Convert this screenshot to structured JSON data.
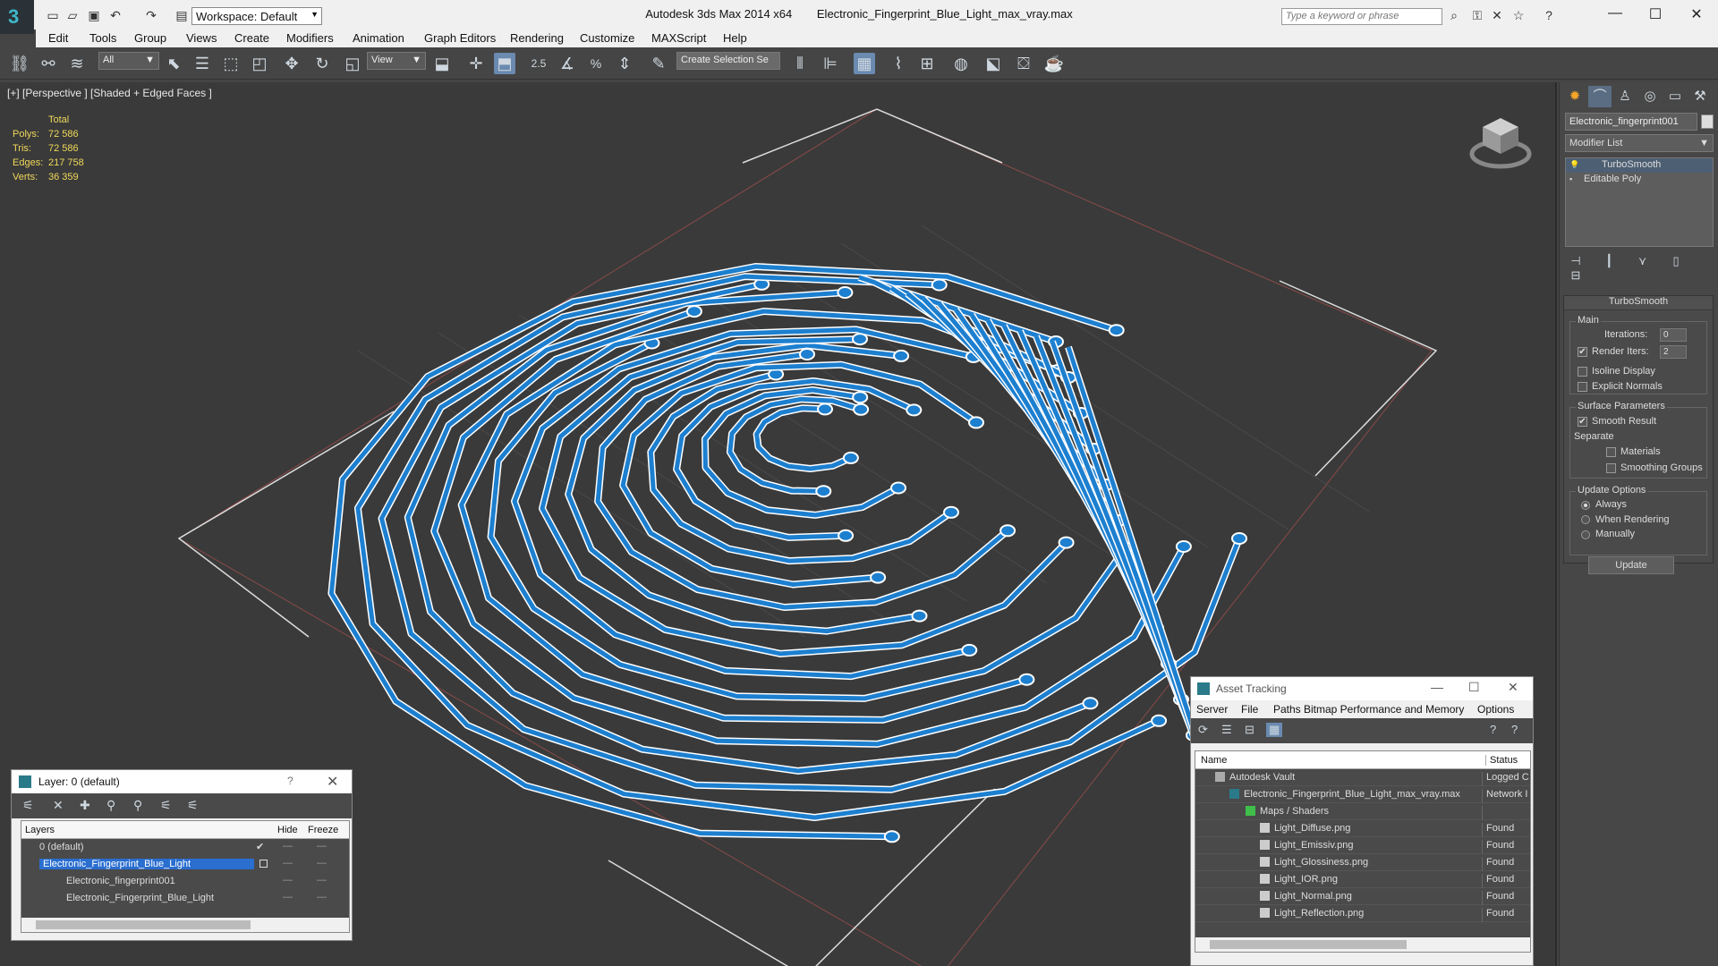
{
  "titlebar": {
    "workspace": "Workspace: Default",
    "app_name": "Autodesk 3ds Max  2014 x64",
    "file_name": "Electronic_Fingerprint_Blue_Light_max_vray.max",
    "search_placeholder": "Type a keyword or phrase"
  },
  "menubar": {
    "items": [
      "Edit",
      "Tools",
      "Group",
      "Views",
      "Create",
      "Modifiers",
      "Animation",
      "Graph Editors",
      "Rendering",
      "Customize",
      "MAXScript",
      "Help"
    ]
  },
  "toolbar": {
    "selection_filter": "All",
    "ref_coord": "View",
    "selection_set": "Create Selection Se",
    "snap_25": "2.5",
    "percent": "%"
  },
  "viewport": {
    "label": "[+] [Perspective ] [Shaded + Edged Faces ]",
    "stats": {
      "header": "Total",
      "rows": [
        {
          "label": "Polys:",
          "value": "72 586"
        },
        {
          "label": "Tris:",
          "value": "72 586"
        },
        {
          "label": "Edges:",
          "value": "217 758"
        },
        {
          "label": "Verts:",
          "value": "36 359"
        }
      ]
    },
    "colors": {
      "trace": "#1d7fcf",
      "edge": "#ffffff",
      "bg": "#3a3a3a"
    }
  },
  "command_panel": {
    "object_name": "Electronic_fingerprint001",
    "modifier_list": "Modifier List",
    "stack": [
      "TurboSmooth",
      "Editable Poly"
    ],
    "turbosmooth": {
      "title": "TurboSmooth",
      "main": "Main",
      "iterations_label": "Iterations:",
      "iterations": "0",
      "render_iters_label": "Render Iters:",
      "render_iters": "2",
      "isoline": "Isoline Display",
      "explicit_normals": "Explicit Normals",
      "surface_params": "Surface Parameters",
      "smooth_result": "Smooth Result",
      "separate": "Separate",
      "materials": "Materials",
      "smoothing_groups": "Smoothing Groups",
      "update_options": "Update Options",
      "always": "Always",
      "when_rendering": "When Rendering",
      "manually": "Manually",
      "update": "Update"
    }
  },
  "layer_window": {
    "title": "Layer: 0 (default)",
    "help": "?",
    "columns": [
      "Layers",
      "Hide",
      "Freeze"
    ],
    "rows": [
      {
        "name": "0 (default)"
      },
      {
        "name": "Electronic_Fingerprint_Blue_Light"
      },
      {
        "name": "Electronic_fingerprint001"
      },
      {
        "name": "Electronic_Fingerprint_Blue_Light"
      }
    ]
  },
  "asset_window": {
    "title": "Asset Tracking",
    "menu": [
      "Server",
      "File",
      "Paths",
      "Bitmap Performance and Memory",
      "Options"
    ],
    "columns": [
      "Name",
      "Status"
    ],
    "rows": [
      {
        "name": "Autodesk Vault",
        "status": "Logged C"
      },
      {
        "name": "Electronic_Fingerprint_Blue_Light_max_vray.max",
        "status": "Network I"
      },
      {
        "name": "Maps / Shaders",
        "status": ""
      },
      {
        "name": "Light_Diffuse.png",
        "status": "Found"
      },
      {
        "name": "Light_Emissiv.png",
        "status": "Found"
      },
      {
        "name": "Light_Glossiness.png",
        "status": "Found"
      },
      {
        "name": "Light_IOR.png",
        "status": "Found"
      },
      {
        "name": "Light_Normal.png",
        "status": "Found"
      },
      {
        "name": "Light_Reflection.png",
        "status": "Found"
      }
    ]
  }
}
